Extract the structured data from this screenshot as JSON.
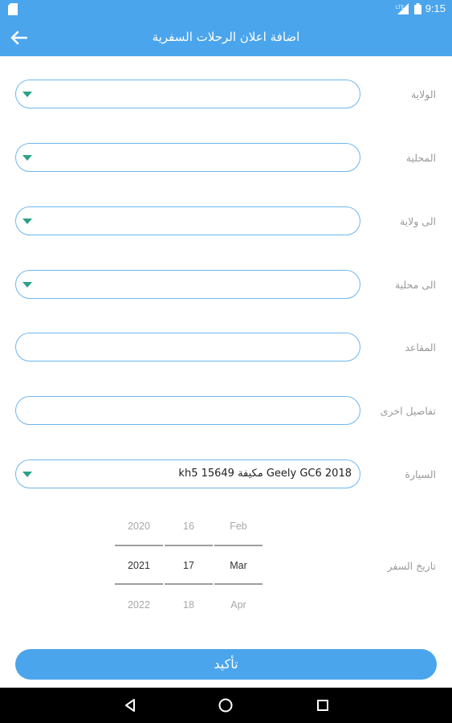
{
  "status_bar": {
    "time": "9:15",
    "network": "LTE"
  },
  "app_bar": {
    "title": "اضافة اعلان الرحلات السفرية"
  },
  "form": {
    "state": {
      "label": "الولاية",
      "value": ""
    },
    "locality": {
      "label": "المحلية",
      "value": ""
    },
    "to_state": {
      "label": "الى ولاية",
      "value": ""
    },
    "to_locality": {
      "label": "الى محلية",
      "value": ""
    },
    "seats": {
      "label": "المقاعد",
      "value": ""
    },
    "other_details": {
      "label": "تفاصيل اخرى",
      "value": ""
    },
    "car": {
      "label": "السيارة",
      "value": "Geely GC6 2018 مكيفة kh5 15649"
    }
  },
  "date_picker": {
    "label": "تاريخ السفر",
    "years": [
      "2020",
      "2021",
      "2022"
    ],
    "days": [
      "16",
      "17",
      "18"
    ],
    "months": [
      "Feb",
      "Mar",
      "Apr"
    ],
    "selected": {
      "year": "2021",
      "day": "17",
      "month": "Mar"
    }
  },
  "confirm_button": {
    "label": "تأكيد"
  },
  "colors": {
    "primary": "#4aa5ec",
    "field_border": "#6fb6ee",
    "caret": "#2aa283"
  },
  "icons": {
    "status_left": "sd-card-icon",
    "status_right": [
      "signal-icon",
      "battery-icon"
    ],
    "app_bar": "back-arrow-icon",
    "nav": [
      "nav-back-icon",
      "nav-home-icon",
      "nav-recents-icon"
    ]
  }
}
